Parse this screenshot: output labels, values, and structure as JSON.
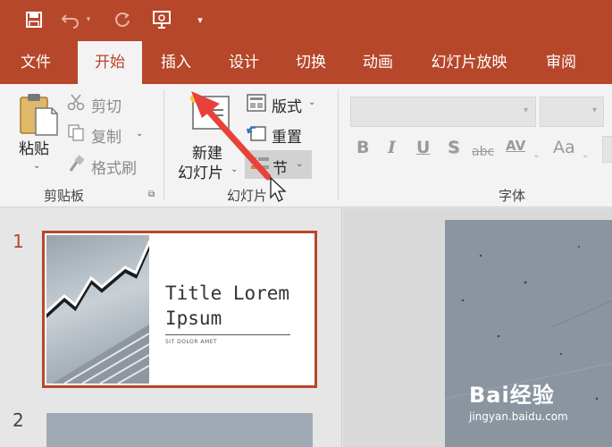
{
  "quick_access": {
    "icons": [
      "save-icon",
      "undo-icon",
      "redo-icon",
      "presentation-icon",
      "customize-dropdown-icon"
    ]
  },
  "tabs": [
    {
      "label": "文件",
      "active": false
    },
    {
      "label": "开始",
      "active": true
    },
    {
      "label": "插入",
      "active": false
    },
    {
      "label": "设计",
      "active": false
    },
    {
      "label": "切换",
      "active": false
    },
    {
      "label": "动画",
      "active": false
    },
    {
      "label": "幻灯片放映",
      "active": false
    },
    {
      "label": "审阅",
      "active": false
    }
  ],
  "clipboard": {
    "paste_label": "粘贴",
    "cut_label": "剪切",
    "copy_label": "复制",
    "format_painter_label": "格式刷",
    "group_label": "剪贴板"
  },
  "slides_group": {
    "new_slide_line1": "新建",
    "new_slide_line2": "幻灯片",
    "layout_label": "版式",
    "reset_label": "重置",
    "section_label": "节",
    "group_label": "幻灯片"
  },
  "font_group": {
    "group_label": "字体",
    "buttons": [
      "B",
      "I",
      "U",
      "S",
      "abc",
      "AV",
      "Aa"
    ]
  },
  "thumbnails": [
    {
      "number": "1",
      "title": "Title Lorem Ipsum",
      "subtitle": "SIT DOLOR AMET",
      "selected": true
    },
    {
      "number": "2",
      "selected": false
    }
  ],
  "watermark": {
    "text": "Bai经验",
    "url": "jingyan.baidu.com"
  },
  "colors": {
    "accent": "#b7472a",
    "ribbon": "#f3f3f3",
    "pointer_arrow": "#e8413c"
  }
}
